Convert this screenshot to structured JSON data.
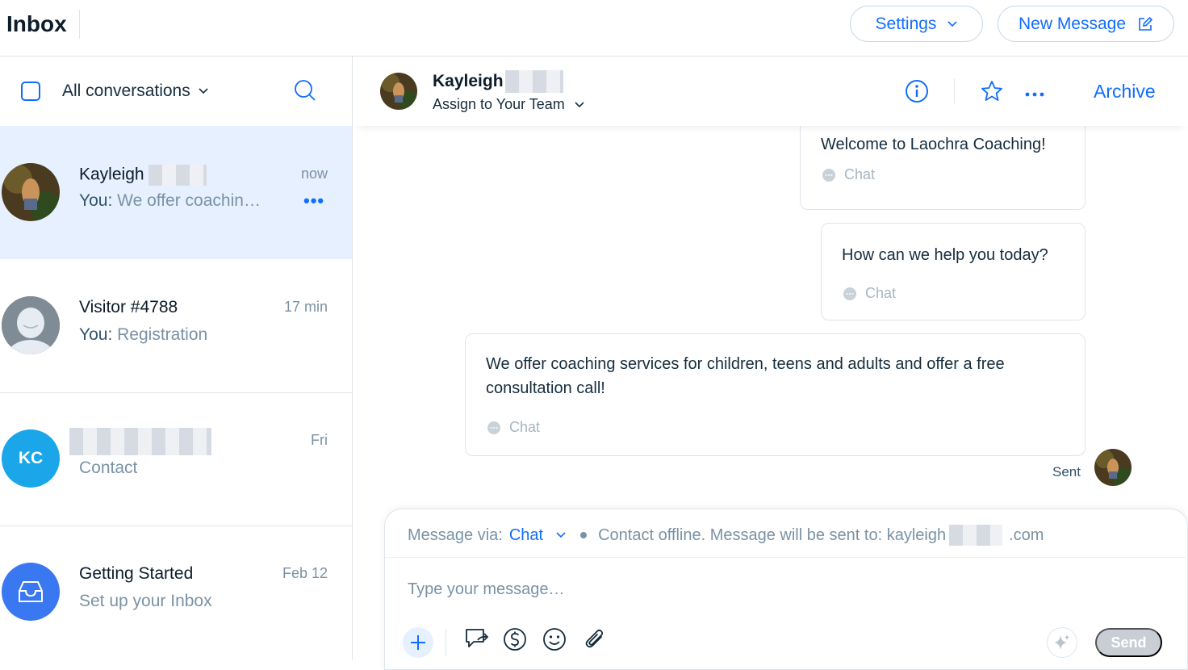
{
  "header": {
    "title": "Inbox",
    "settings_label": "Settings",
    "new_message_label": "New Message"
  },
  "sidebar": {
    "filter_label": "All conversations",
    "conversations": [
      {
        "name": "Kayleigh",
        "you": "You:",
        "preview": "We offer coachin…",
        "time": "now"
      },
      {
        "name": "Visitor #4788",
        "you": "You:",
        "preview": "Registration",
        "time": "17 min"
      },
      {
        "initials": "KC",
        "preview": "Contact",
        "time": "Fri"
      },
      {
        "name": "Getting Started",
        "preview": "Set up your Inbox",
        "time": "Feb 12"
      }
    ]
  },
  "chat": {
    "contact_name": "Kayleigh",
    "assign_label": "Assign to Your Team",
    "archive_label": "Archive",
    "messages": [
      {
        "text": "Welcome to Laochra Coaching!",
        "channel": "Chat"
      },
      {
        "text": "How can we help you today?",
        "channel": "Chat"
      },
      {
        "text": "We offer coaching services for children, teens and adults and offer a free consultation call!",
        "channel": "Chat"
      }
    ],
    "sent_label": "Sent"
  },
  "composer": {
    "via_label": "Message via:",
    "via_channel": "Chat",
    "offline_text": "Contact offline. Message will be sent to: kayleigh",
    "offline_suffix": ".com",
    "placeholder": "Type your message…",
    "send_label": "Send"
  },
  "colors": {
    "accent": "#116dff",
    "active_row": "#e7f0ff",
    "kc_avatar": "#1aa6e8",
    "inbox_avatar": "#3a78f2"
  }
}
